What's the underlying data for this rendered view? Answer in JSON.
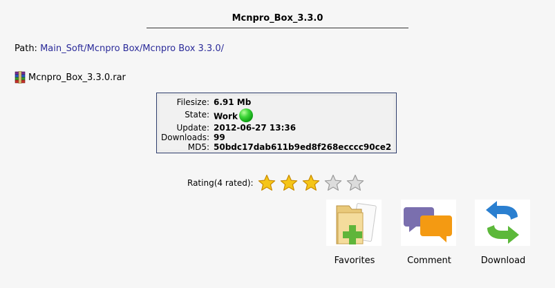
{
  "title": "Mcnpro_Box_3.3.0",
  "path": {
    "label": "Path:",
    "segments": [
      "Main_Soft",
      "Mcnpro Box",
      "Mcnpro Box 3.3.0"
    ],
    "trailing": "/"
  },
  "file": {
    "name": "Mcnpro_Box_3.3.0.rar",
    "icon": "winrar-archive-icon"
  },
  "info": {
    "filesize_label": "Filesize:",
    "filesize": "6.91 Mb",
    "state_label": "State:",
    "state": "Work",
    "state_indicator_color": "#1fbf1f",
    "update_label": "Update:",
    "update": "2012-06-27 13:36",
    "downloads_label": "Downloads:",
    "downloads": "99",
    "md5_label": "MD5:",
    "md5": "50bdc17dab611b9ed8f268ecccc90ce2"
  },
  "rating": {
    "label": "Rating(4 rated):",
    "value": 3,
    "max": 5,
    "filled_color": "#f5c518",
    "empty_color": "#dcdcdc"
  },
  "actions": {
    "favorites": "Favorites",
    "comment": "Comment",
    "download": "Download"
  },
  "colors": {
    "link": "#2a2a99",
    "box_border": "#2d3c6b"
  }
}
